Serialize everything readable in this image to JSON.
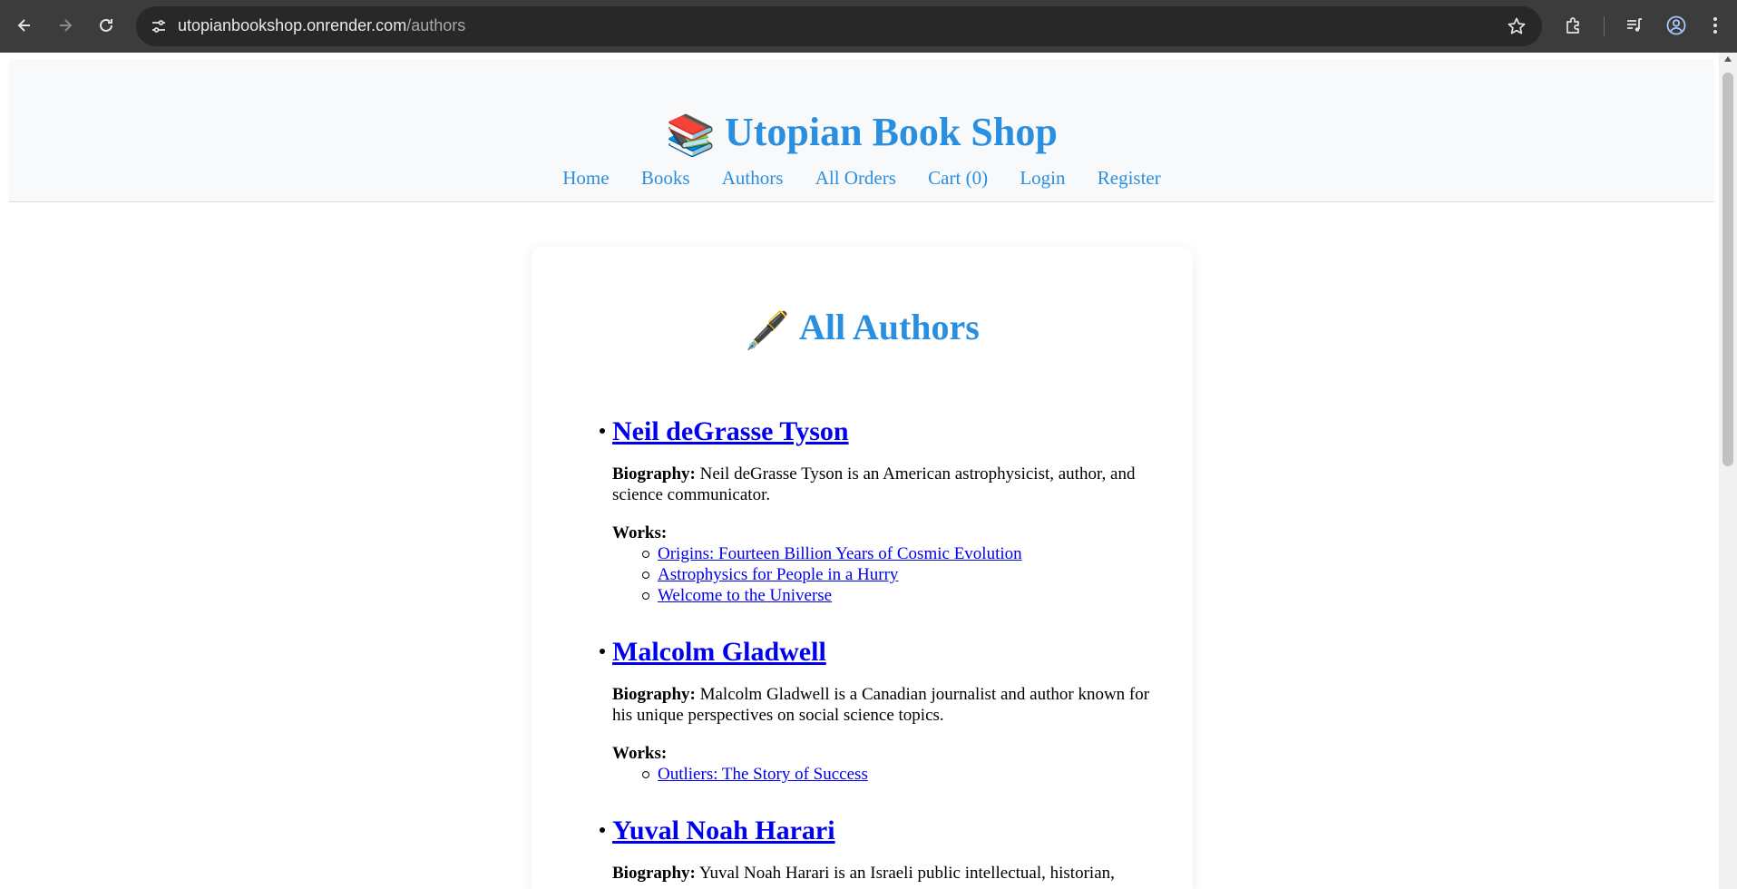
{
  "browser": {
    "url_host": "utopianbookshop.onrender.com",
    "url_path": "/authors"
  },
  "site": {
    "title": "Utopian Book Shop",
    "title_emoji": "📚",
    "nav": [
      "Home",
      "Books",
      "Authors",
      "All Orders",
      "Cart (0)",
      "Login",
      "Register"
    ]
  },
  "page": {
    "heading": "All Authors",
    "heading_emoji": "🖋️",
    "biography_label": "Biography:",
    "works_label": "Works:"
  },
  "authors": [
    {
      "name": "Neil deGrasse Tyson",
      "bio": "Neil deGrasse Tyson is an American astrophysicist, author, and science communicator.",
      "works": [
        "Origins: Fourteen Billion Years of Cosmic Evolution",
        "Astrophysics for People in a Hurry",
        "Welcome to the Universe"
      ]
    },
    {
      "name": "Malcolm Gladwell",
      "bio": "Malcolm Gladwell is a Canadian journalist and author known for his unique perspectives on social science topics.",
      "works": [
        "Outliers: The Story of Success"
      ]
    },
    {
      "name": "Yuval Noah Harari",
      "bio": "Yuval Noah Harari is an Israeli public intellectual, historian,",
      "works": []
    }
  ],
  "colors": {
    "brand_blue": "#2b8fe0",
    "link_blue": "#0000ee",
    "chrome_dark": "#3c3c3c"
  }
}
